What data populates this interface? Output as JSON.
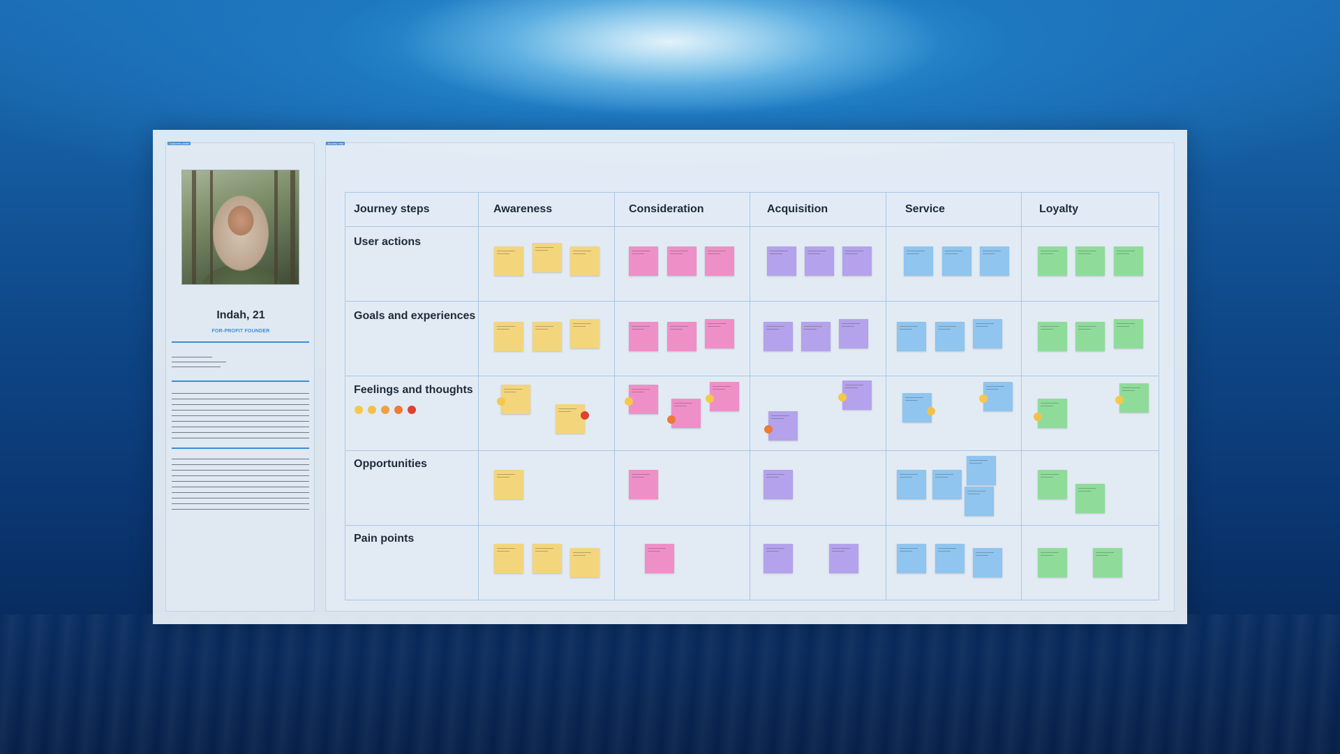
{
  "persona": {
    "tag": "Customer profile",
    "name": "Indah, 21",
    "role": "FOR-PROFIT FOUNDER"
  },
  "board": {
    "tag": "Journey map",
    "columns": [
      "Journey steps",
      "Awareness",
      "Consideration",
      "Acquisition",
      "Service",
      "Loyalty"
    ],
    "rows": [
      "User actions",
      "Goals and experiences",
      "Feelings and thoughts",
      "Opportunities",
      "Pain points"
    ]
  },
  "emotion_scale": [
    "very-happy",
    "happy",
    "neutral",
    "sad",
    "angry"
  ],
  "colors": {
    "awareness": "#f3d57c",
    "consideration": "#ef8fc8",
    "acquisition": "#b4a2ec",
    "service": "#8fc5ef",
    "loyalty": "#8fdc9a",
    "accent": "#3f8bd6"
  }
}
